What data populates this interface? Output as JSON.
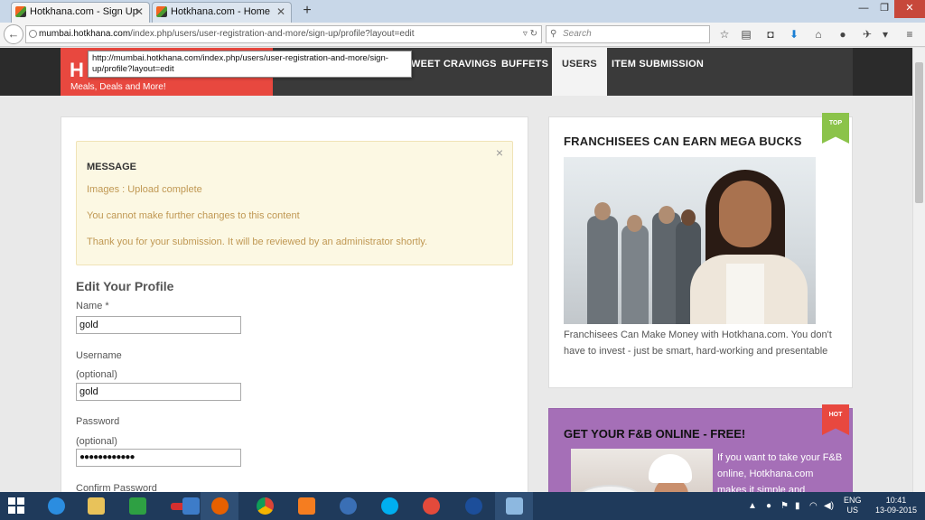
{
  "browser": {
    "tabs": [
      {
        "title": "Hotkhana.com - Sign Up",
        "active": true
      },
      {
        "title": "Hotkhana.com - Home",
        "active": false
      }
    ],
    "new_tab_icon": "plus-icon",
    "url_host": "mumbai.hotkhana.com",
    "url_path": "/index.php/users/user-registration-and-more/sign-up/profile?layout=edit",
    "search_placeholder": "Search",
    "link_tooltip": "http://mumbai.hotkhana.com/index.php/users/user-registration-and-more/sign-up/profile?layout=edit"
  },
  "site": {
    "logo_text": "H",
    "logo_tagline": "Meals, Deals and More!",
    "menu": [
      {
        "label": "WEET CRAVINGS",
        "active": false
      },
      {
        "label": "BUFFETS",
        "active": false
      },
      {
        "label": "USERS",
        "active": true
      },
      {
        "label": "ITEM SUBMISSION",
        "active": false
      }
    ]
  },
  "message": {
    "title": "MESSAGE",
    "close_glyph": "×",
    "lines": [
      "Images : Upload complete",
      "You cannot make further changes to this content",
      "Thank you for your submission. It will be reviewed by an administrator shortly."
    ]
  },
  "form": {
    "title": "Edit Your Profile",
    "name_label": "Name *",
    "name_value": "gold",
    "username_label": "Username",
    "username_note": "(optional)",
    "username_value": "gold",
    "password_label": "Password",
    "password_note": "(optional)",
    "password_value": "●●●●●●●●●●●●",
    "confirm_label": "Confirm Password"
  },
  "sidebar": {
    "card1": {
      "ribbon": "TOP",
      "title": "FRANCHISEES CAN EARN MEGA BUCKS",
      "text": "Franchisees Can Make Money with Hotkhana.com. You don't have to invest - just be smart, hard-working and presentable"
    },
    "card2": {
      "ribbon": "HOT",
      "title": "GET YOUR F&B ONLINE - FREE!",
      "text": "If you want to take your F&B online, Hotkhana.com makes it simple and"
    }
  },
  "taskbar": {
    "language": "ENG",
    "region": "US",
    "time": "10:41",
    "date": "13-09-2015"
  },
  "colors": {
    "brand_red": "#e8483f",
    "menu_dark": "#3a3a3a",
    "message_bg": "#fcf8e3",
    "message_text": "#c09853",
    "ribbon_green": "#8bc34a",
    "promo_purple": "#a56fb7",
    "taskbar_blue": "#1f3a5b"
  }
}
